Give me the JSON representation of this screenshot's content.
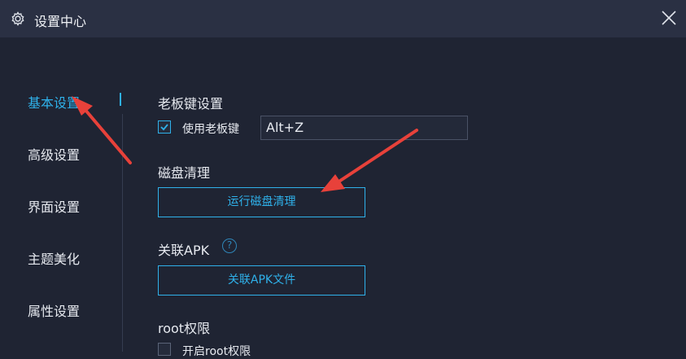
{
  "window": {
    "title": "设置中心"
  },
  "sidebar": {
    "items": [
      {
        "label": "基本设置",
        "active": true
      },
      {
        "label": "高级设置"
      },
      {
        "label": "界面设置"
      },
      {
        "label": "主题美化"
      },
      {
        "label": "属性设置"
      }
    ]
  },
  "boss_key": {
    "title": "老板键设置",
    "checkbox_label": "使用老板键",
    "checked": true,
    "hotkey_value": "Alt+Z"
  },
  "disk_clean": {
    "title": "磁盘清理",
    "button_label": "运行磁盘清理"
  },
  "apk": {
    "title": "关联APK",
    "help_icon": "?",
    "button_label": "关联APK文件"
  },
  "root": {
    "title": "root权限",
    "checkbox_label": "开启root权限",
    "checked": false
  },
  "colors": {
    "accent": "#2fb1ea",
    "background": "#1f2433",
    "titlebar": "#2a3043",
    "annotation_arrow": "#e8413a"
  }
}
